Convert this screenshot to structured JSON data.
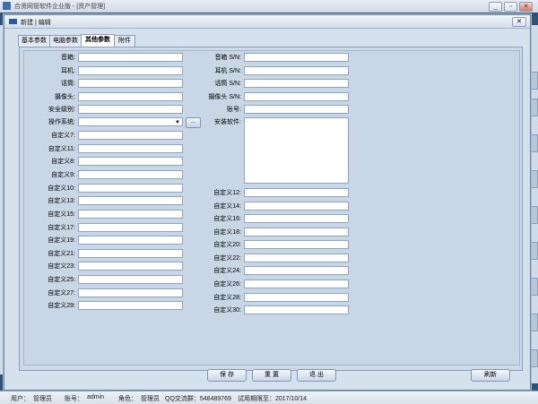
{
  "app": {
    "title": "合贤网管软件企业版 - [资产管理]",
    "min": "_",
    "max": "▫",
    "close": "✕"
  },
  "dialog": {
    "title": "新建 | 编辑",
    "close": "✕"
  },
  "tabs": [
    {
      "label": "基本参数"
    },
    {
      "label": "电脑参数"
    },
    {
      "label": "其他参数"
    },
    {
      "label": "附件"
    }
  ],
  "left_fields": [
    {
      "label": "音箱:",
      "value": ""
    },
    {
      "label": "耳机:",
      "value": ""
    },
    {
      "label": "话筒:",
      "value": ""
    },
    {
      "label": "摄像头:",
      "value": ""
    },
    {
      "label": "安全级别:",
      "value": ""
    },
    {
      "label": "操作系统:",
      "value": ""
    },
    {
      "label": "自定义7:",
      "value": ""
    },
    {
      "label": "自定义11:",
      "value": ""
    },
    {
      "label": "自定义8:",
      "value": ""
    },
    {
      "label": "自定义9:",
      "value": ""
    },
    {
      "label": "自定义10:",
      "value": ""
    },
    {
      "label": "自定义13:",
      "value": ""
    },
    {
      "label": "自定义15:",
      "value": ""
    },
    {
      "label": "自定义17:",
      "value": ""
    },
    {
      "label": "自定义19:",
      "value": ""
    },
    {
      "label": "自定义21:",
      "value": ""
    },
    {
      "label": "自定义23:",
      "value": ""
    },
    {
      "label": "自定义25:",
      "value": ""
    },
    {
      "label": "自定义27:",
      "value": ""
    },
    {
      "label": "自定义29:",
      "value": ""
    }
  ],
  "right_fields_top": [
    {
      "label": "音箱 S/N:",
      "value": ""
    },
    {
      "label": "耳机 S/N:",
      "value": ""
    },
    {
      "label": "话筒 S/N:",
      "value": ""
    },
    {
      "label": "摄像头 S/N:",
      "value": ""
    },
    {
      "label": "账号:",
      "value": ""
    }
  ],
  "installed_software": {
    "label": "安装软件:",
    "value": ""
  },
  "right_fields_bottom": [
    {
      "label": "自定义12:",
      "value": ""
    },
    {
      "label": "自定义14:",
      "value": ""
    },
    {
      "label": "自定义16:",
      "value": ""
    },
    {
      "label": "自定义18:",
      "value": ""
    },
    {
      "label": "自定义20:",
      "value": ""
    },
    {
      "label": "自定义22:",
      "value": ""
    },
    {
      "label": "自定义24:",
      "value": ""
    },
    {
      "label": "自定义26:",
      "value": ""
    },
    {
      "label": "自定义28:",
      "value": ""
    },
    {
      "label": "自定义30:",
      "value": ""
    }
  ],
  "os_dropdown_caret": "▼",
  "os_extra_button": "...",
  "buttons": {
    "save": "保 存",
    "reset": "重 置",
    "exit": "退 出",
    "refresh": "刷新"
  },
  "status": {
    "user_label": "用户：",
    "user_value": "管理员",
    "account_label": "账号：",
    "account_value": "admin",
    "role_label": "角色：",
    "role_value": "管理员",
    "qq_group": "QQ交流群：548489769",
    "trial": "试用期限至：2017/10/14"
  },
  "colors": {
    "dialog_bg": "#d6e1ee",
    "panel_bg": "#c9d6e5",
    "input_border": "#8ea3bd"
  }
}
